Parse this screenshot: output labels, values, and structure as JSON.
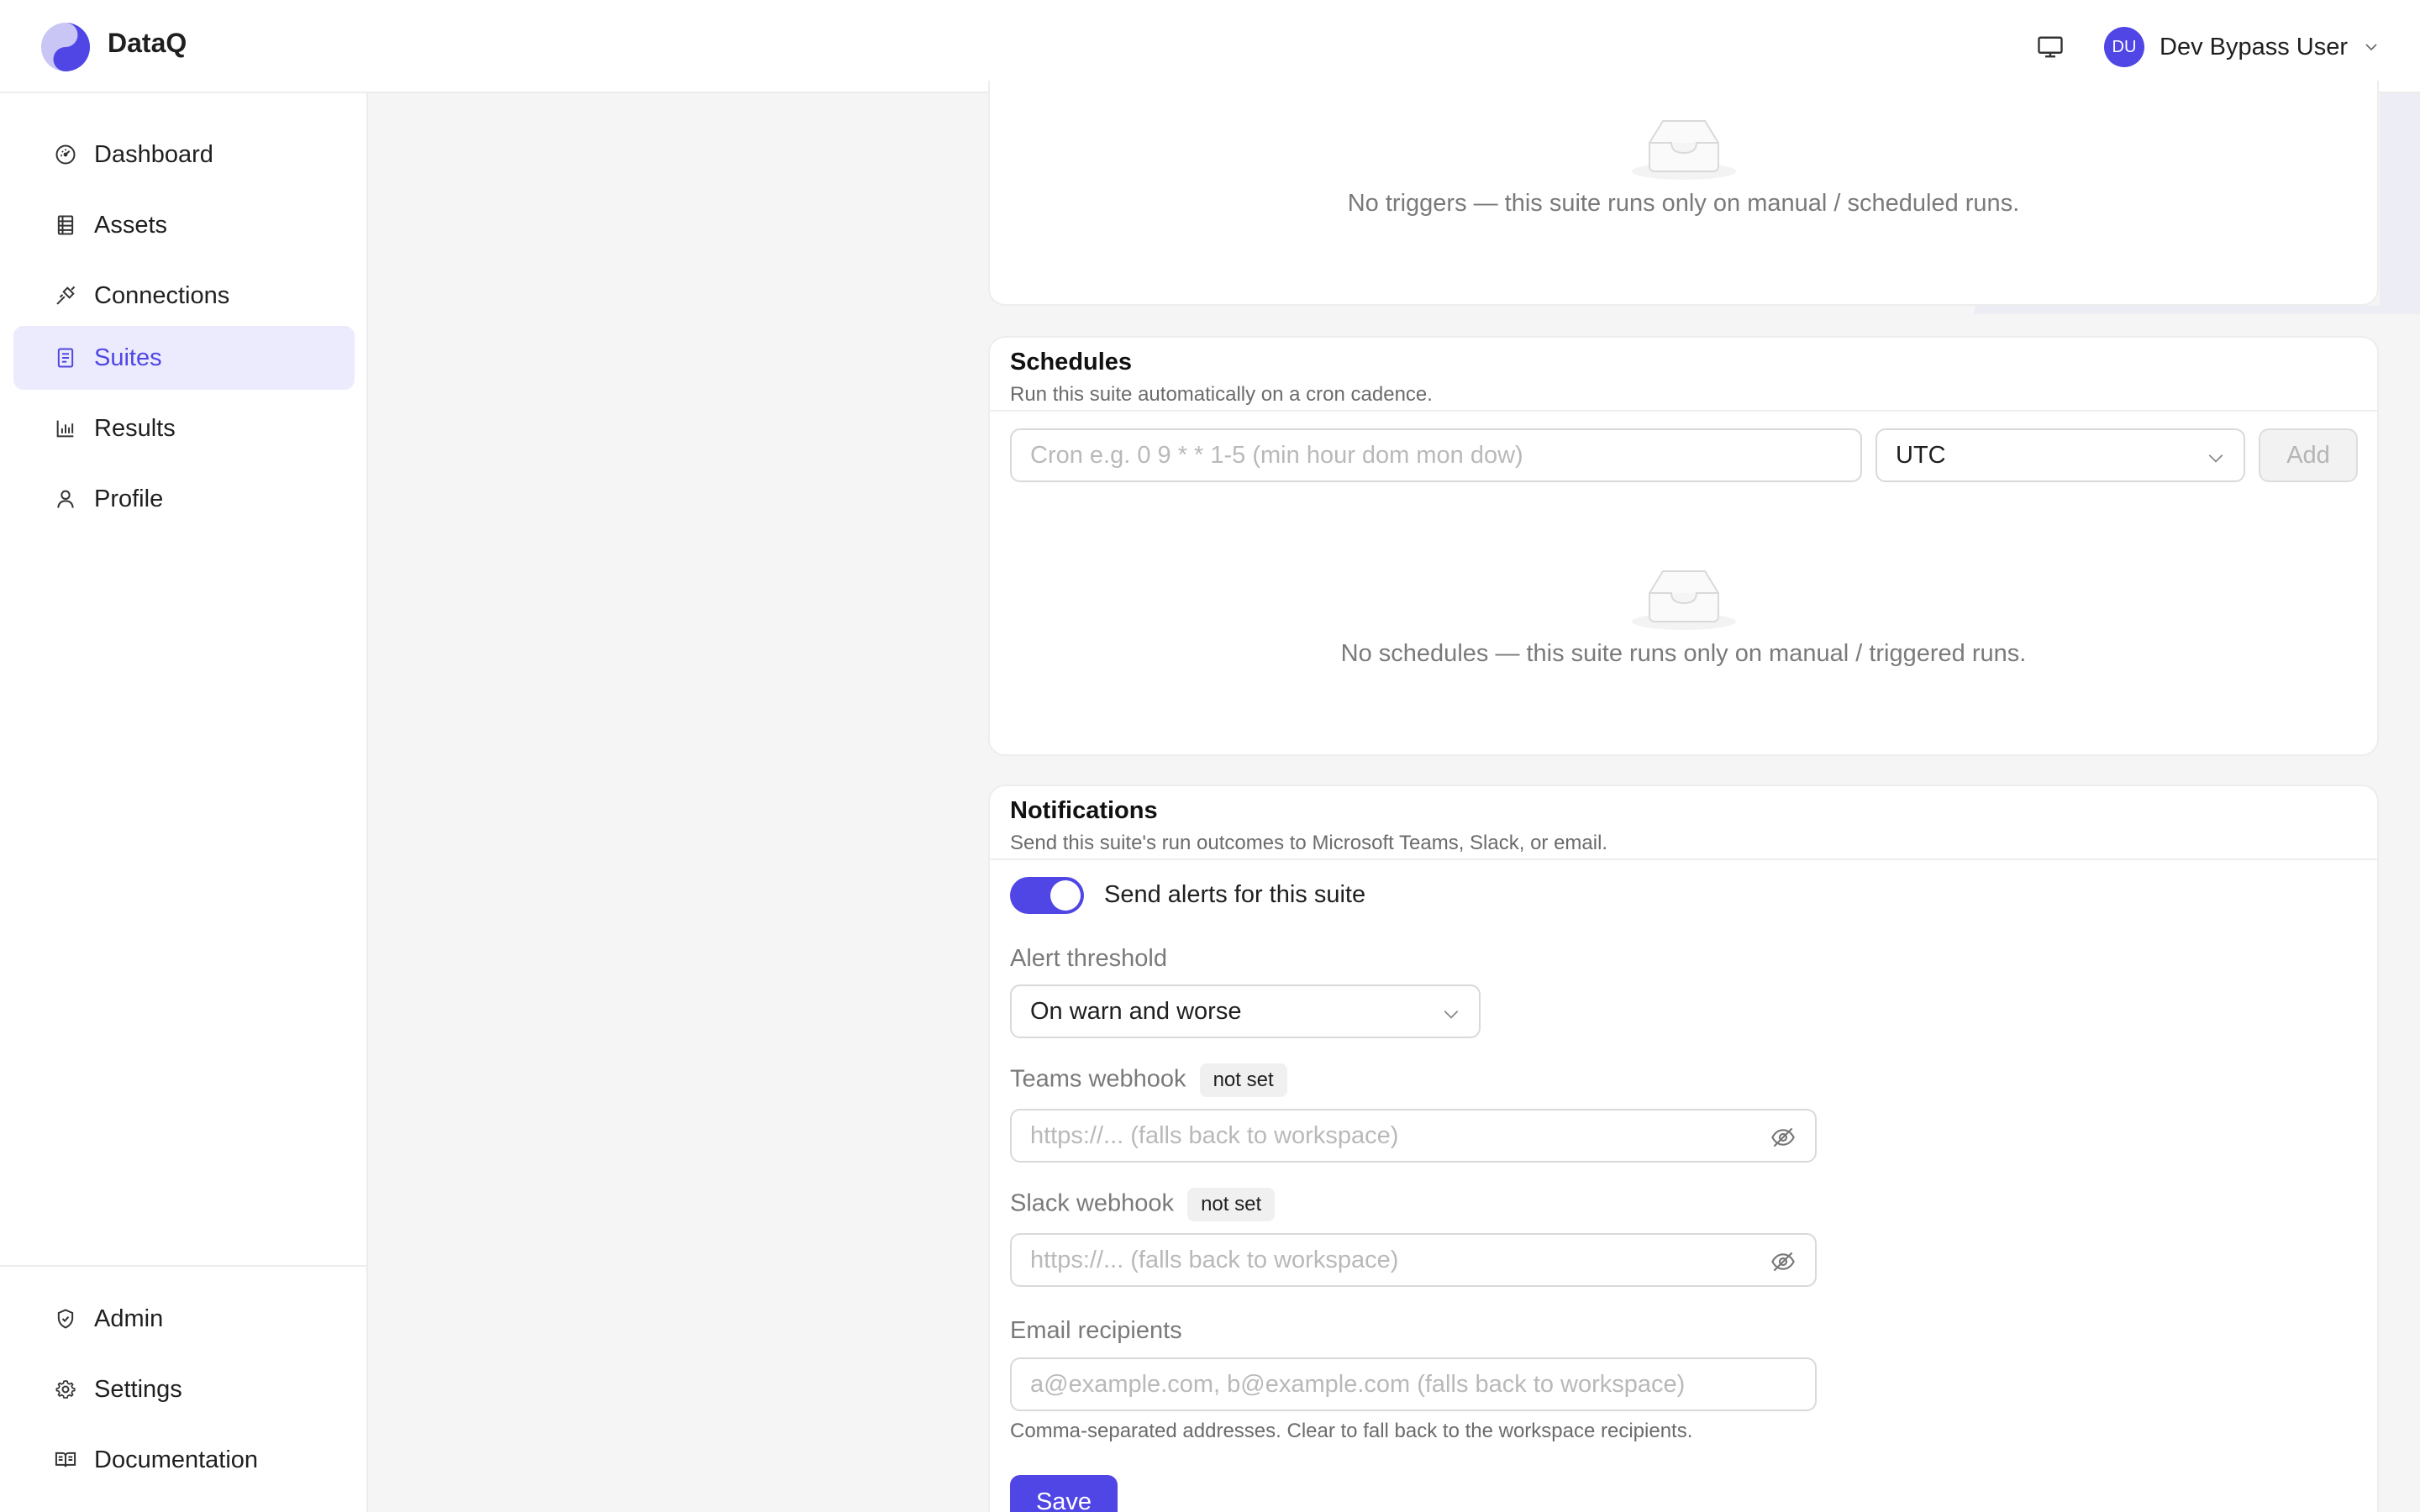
{
  "header": {
    "app_title": "DataQ",
    "user": {
      "initials": "DU",
      "name": "Dev Bypass User"
    }
  },
  "sidebar": {
    "items": [
      {
        "label": "Dashboard",
        "icon": "gauge-icon"
      },
      {
        "label": "Assets",
        "icon": "table-icon"
      },
      {
        "label": "Connections",
        "icon": "plug-icon"
      },
      {
        "label": "Suites",
        "icon": "checklist-icon",
        "active": true
      },
      {
        "label": "Results",
        "icon": "bar-chart-icon"
      },
      {
        "label": "Profile",
        "icon": "user-icon"
      }
    ],
    "bottom_items": [
      {
        "label": "Admin",
        "icon": "shield-check-icon"
      },
      {
        "label": "Settings",
        "icon": "gear-icon"
      },
      {
        "label": "Documentation",
        "icon": "book-icon"
      }
    ]
  },
  "triggers": {
    "empty_text": "No triggers — this suite runs only on manual / scheduled runs."
  },
  "schedules": {
    "title": "Schedules",
    "subtitle": "Run this suite automatically on a cron cadence.",
    "cron_placeholder": "Cron e.g. 0 9 * * 1-5 (min hour dom mon dow)",
    "timezone": "UTC",
    "add_label": "Add",
    "empty_text": "No schedules — this suite runs only on manual / triggered runs."
  },
  "notifications": {
    "title": "Notifications",
    "subtitle": "Send this suite's run outcomes to Microsoft Teams, Slack, or email.",
    "toggle_label": "Send alerts for this suite",
    "toggle_on": true,
    "threshold_label": "Alert threshold",
    "threshold_value": "On warn and worse",
    "teams_label": "Teams webhook",
    "teams_tag": "not set",
    "teams_placeholder": "https://... (falls back to workspace)",
    "slack_label": "Slack webhook",
    "slack_tag": "not set",
    "slack_placeholder": "https://... (falls back to workspace)",
    "email_label": "Email recipients",
    "email_placeholder": "a@example.com, b@example.com (falls back to workspace)",
    "email_hint": "Comma-separated addresses. Clear to fall back to the workspace recipients.",
    "save_label": "Save"
  },
  "colors": {
    "accent": "#4f46e5",
    "active_nav_bg": "#ecebfd"
  }
}
